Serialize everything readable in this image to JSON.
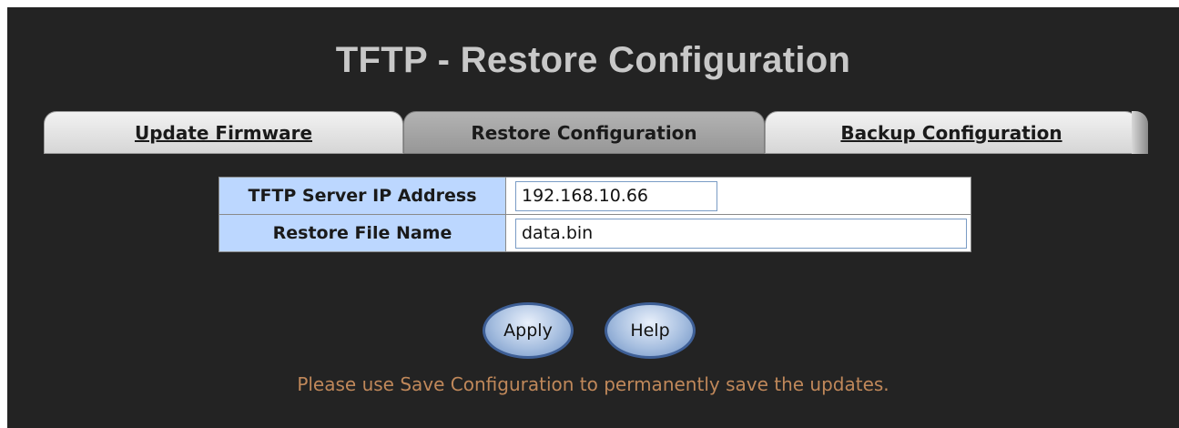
{
  "page": {
    "title": "TFTP - Restore Configuration"
  },
  "tabs": [
    {
      "label": "Update Firmware",
      "active": false
    },
    {
      "label": "Restore Configuration",
      "active": true
    },
    {
      "label": "Backup Configuration",
      "active": false
    }
  ],
  "form": {
    "server_ip": {
      "label": "TFTP Server IP Address",
      "value": "192.168.10.66"
    },
    "file_name": {
      "label": "Restore File Name",
      "value": "data.bin"
    }
  },
  "buttons": {
    "apply": "Apply",
    "help": "Help"
  },
  "note": "Please use Save Configuration to permanently save the updates.",
  "colors": {
    "background": "#232323",
    "title": "#c8c8c8",
    "label_cell": "#bcd7ff",
    "note": "#c0885a",
    "button_border": "#3e5f96"
  }
}
